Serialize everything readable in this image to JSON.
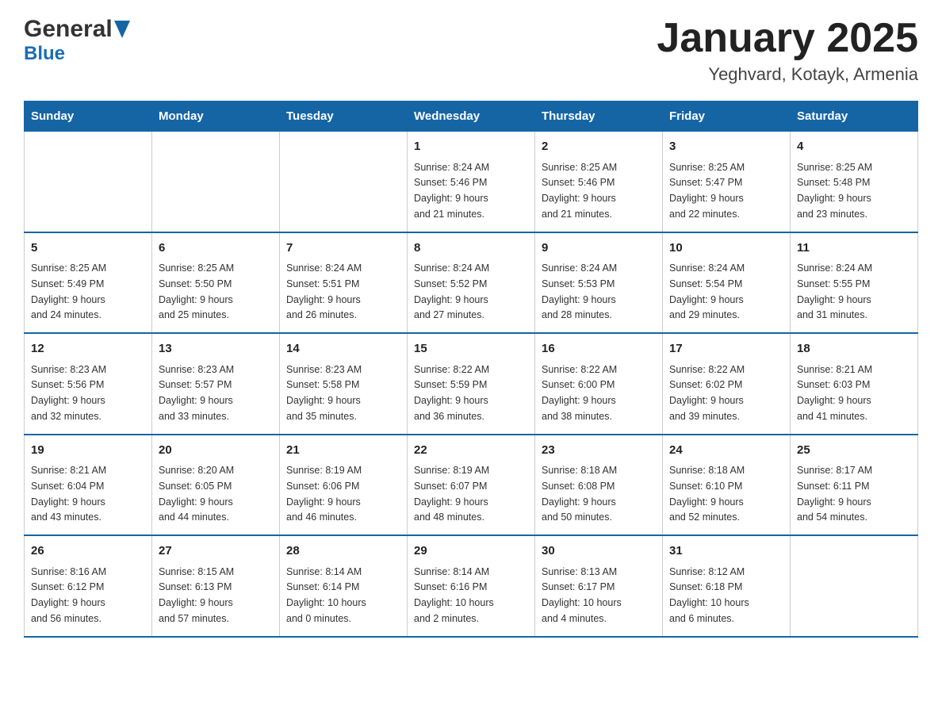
{
  "header": {
    "title": "January 2025",
    "subtitle": "Yeghvard, Kotayk, Armenia",
    "logo_general": "General",
    "logo_blue": "Blue"
  },
  "days_of_week": [
    "Sunday",
    "Monday",
    "Tuesday",
    "Wednesday",
    "Thursday",
    "Friday",
    "Saturday"
  ],
  "weeks": [
    [
      {
        "day": "",
        "info": ""
      },
      {
        "day": "",
        "info": ""
      },
      {
        "day": "",
        "info": ""
      },
      {
        "day": "1",
        "info": "Sunrise: 8:24 AM\nSunset: 5:46 PM\nDaylight: 9 hours\nand 21 minutes."
      },
      {
        "day": "2",
        "info": "Sunrise: 8:25 AM\nSunset: 5:46 PM\nDaylight: 9 hours\nand 21 minutes."
      },
      {
        "day": "3",
        "info": "Sunrise: 8:25 AM\nSunset: 5:47 PM\nDaylight: 9 hours\nand 22 minutes."
      },
      {
        "day": "4",
        "info": "Sunrise: 8:25 AM\nSunset: 5:48 PM\nDaylight: 9 hours\nand 23 minutes."
      }
    ],
    [
      {
        "day": "5",
        "info": "Sunrise: 8:25 AM\nSunset: 5:49 PM\nDaylight: 9 hours\nand 24 minutes."
      },
      {
        "day": "6",
        "info": "Sunrise: 8:25 AM\nSunset: 5:50 PM\nDaylight: 9 hours\nand 25 minutes."
      },
      {
        "day": "7",
        "info": "Sunrise: 8:24 AM\nSunset: 5:51 PM\nDaylight: 9 hours\nand 26 minutes."
      },
      {
        "day": "8",
        "info": "Sunrise: 8:24 AM\nSunset: 5:52 PM\nDaylight: 9 hours\nand 27 minutes."
      },
      {
        "day": "9",
        "info": "Sunrise: 8:24 AM\nSunset: 5:53 PM\nDaylight: 9 hours\nand 28 minutes."
      },
      {
        "day": "10",
        "info": "Sunrise: 8:24 AM\nSunset: 5:54 PM\nDaylight: 9 hours\nand 29 minutes."
      },
      {
        "day": "11",
        "info": "Sunrise: 8:24 AM\nSunset: 5:55 PM\nDaylight: 9 hours\nand 31 minutes."
      }
    ],
    [
      {
        "day": "12",
        "info": "Sunrise: 8:23 AM\nSunset: 5:56 PM\nDaylight: 9 hours\nand 32 minutes."
      },
      {
        "day": "13",
        "info": "Sunrise: 8:23 AM\nSunset: 5:57 PM\nDaylight: 9 hours\nand 33 minutes."
      },
      {
        "day": "14",
        "info": "Sunrise: 8:23 AM\nSunset: 5:58 PM\nDaylight: 9 hours\nand 35 minutes."
      },
      {
        "day": "15",
        "info": "Sunrise: 8:22 AM\nSunset: 5:59 PM\nDaylight: 9 hours\nand 36 minutes."
      },
      {
        "day": "16",
        "info": "Sunrise: 8:22 AM\nSunset: 6:00 PM\nDaylight: 9 hours\nand 38 minutes."
      },
      {
        "day": "17",
        "info": "Sunrise: 8:22 AM\nSunset: 6:02 PM\nDaylight: 9 hours\nand 39 minutes."
      },
      {
        "day": "18",
        "info": "Sunrise: 8:21 AM\nSunset: 6:03 PM\nDaylight: 9 hours\nand 41 minutes."
      }
    ],
    [
      {
        "day": "19",
        "info": "Sunrise: 8:21 AM\nSunset: 6:04 PM\nDaylight: 9 hours\nand 43 minutes."
      },
      {
        "day": "20",
        "info": "Sunrise: 8:20 AM\nSunset: 6:05 PM\nDaylight: 9 hours\nand 44 minutes."
      },
      {
        "day": "21",
        "info": "Sunrise: 8:19 AM\nSunset: 6:06 PM\nDaylight: 9 hours\nand 46 minutes."
      },
      {
        "day": "22",
        "info": "Sunrise: 8:19 AM\nSunset: 6:07 PM\nDaylight: 9 hours\nand 48 minutes."
      },
      {
        "day": "23",
        "info": "Sunrise: 8:18 AM\nSunset: 6:08 PM\nDaylight: 9 hours\nand 50 minutes."
      },
      {
        "day": "24",
        "info": "Sunrise: 8:18 AM\nSunset: 6:10 PM\nDaylight: 9 hours\nand 52 minutes."
      },
      {
        "day": "25",
        "info": "Sunrise: 8:17 AM\nSunset: 6:11 PM\nDaylight: 9 hours\nand 54 minutes."
      }
    ],
    [
      {
        "day": "26",
        "info": "Sunrise: 8:16 AM\nSunset: 6:12 PM\nDaylight: 9 hours\nand 56 minutes."
      },
      {
        "day": "27",
        "info": "Sunrise: 8:15 AM\nSunset: 6:13 PM\nDaylight: 9 hours\nand 57 minutes."
      },
      {
        "day": "28",
        "info": "Sunrise: 8:14 AM\nSunset: 6:14 PM\nDaylight: 10 hours\nand 0 minutes."
      },
      {
        "day": "29",
        "info": "Sunrise: 8:14 AM\nSunset: 6:16 PM\nDaylight: 10 hours\nand 2 minutes."
      },
      {
        "day": "30",
        "info": "Sunrise: 8:13 AM\nSunset: 6:17 PM\nDaylight: 10 hours\nand 4 minutes."
      },
      {
        "day": "31",
        "info": "Sunrise: 8:12 AM\nSunset: 6:18 PM\nDaylight: 10 hours\nand 6 minutes."
      },
      {
        "day": "",
        "info": ""
      }
    ]
  ]
}
